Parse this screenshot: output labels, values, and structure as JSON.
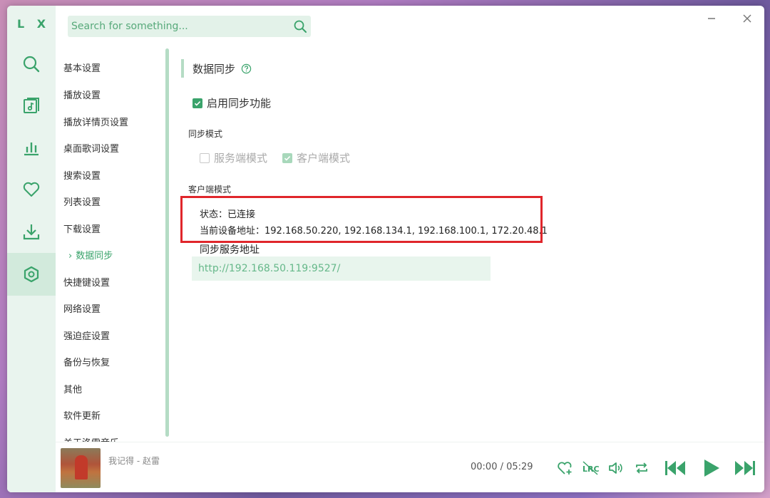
{
  "app": {
    "logo": "L X"
  },
  "search": {
    "placeholder": "Search for something..."
  },
  "nav": {
    "items": [
      "基本设置",
      "播放设置",
      "播放详情页设置",
      "桌面歌词设置",
      "搜索设置",
      "列表设置",
      "下载设置",
      "数据同步",
      "快捷键设置",
      "网络设置",
      "强迫症设置",
      "备份与恢复",
      "其他",
      "软件更新",
      "关于洛雪音乐"
    ],
    "active_marker": "›"
  },
  "sync": {
    "title": "数据同步",
    "enable_label": "启用同步功能",
    "mode_heading": "同步模式",
    "server_mode_label": "服务端模式",
    "client_mode_label": "客户端模式",
    "client_heading": "客户端模式",
    "status": "状态：已连接",
    "device_addr": "当前设备地址：192.168.50.220, 192.168.134.1, 192.168.100.1, 172.20.48.1",
    "service_addr_label": "同步服务地址",
    "service_addr_value": "http://192.168.50.119:9527/"
  },
  "player": {
    "song": "我记得 - 赵雷",
    "time": "00:00 / 05:29"
  },
  "colors": {
    "accent": "#3aa36b",
    "highlight_box": "#e0262b",
    "rail_bg": "#e9f4ee"
  }
}
